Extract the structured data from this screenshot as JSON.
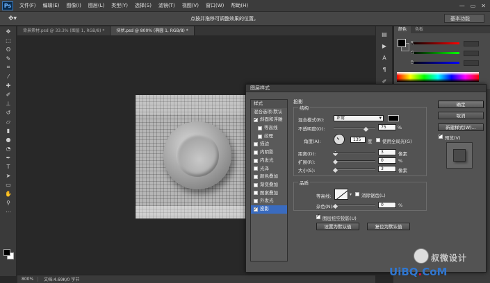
{
  "app": {
    "logo": "Ps"
  },
  "menu": [
    "文件(F)",
    "编辑(E)",
    "图像(I)",
    "图层(L)",
    "类型(Y)",
    "选择(S)",
    "滤镜(T)",
    "视图(V)",
    "窗口(W)",
    "帮助(H)"
  ],
  "window_controls": [
    "—",
    "▭",
    "✕"
  ],
  "options_bar": {
    "tool_icon": "move-tool",
    "hint": "点按并拖移可调整效果的位置。",
    "workspace": "基本功能"
  },
  "doc_tabs": [
    {
      "label": "背景素材.psd @ 33.3% (图层 1, RGB/8) *",
      "active": false
    },
    {
      "label": "块状.psd @ 800% (椭圆 1, RGB/8) *",
      "active": true
    }
  ],
  "status": {
    "zoom": "800%",
    "doc": "文档:4.69K/0 字节"
  },
  "color_panel": {
    "tabs": [
      "颜色",
      "色板"
    ],
    "sliders": [
      "R",
      "G",
      "B"
    ]
  },
  "dialog": {
    "title": "图层样式",
    "styles_header": "样式",
    "blend_options": "混合选项:默认",
    "styles": [
      {
        "label": "斜面和浮雕",
        "checked": true,
        "indent": false
      },
      {
        "label": "等高线",
        "checked": false,
        "indent": true
      },
      {
        "label": "纹理",
        "checked": false,
        "indent": true
      },
      {
        "label": "描边",
        "checked": false,
        "indent": false
      },
      {
        "label": "内阴影",
        "checked": false,
        "indent": false
      },
      {
        "label": "内发光",
        "checked": false,
        "indent": false
      },
      {
        "label": "光泽",
        "checked": false,
        "indent": false
      },
      {
        "label": "颜色叠加",
        "checked": false,
        "indent": false
      },
      {
        "label": "渐变叠加",
        "checked": false,
        "indent": false
      },
      {
        "label": "图案叠加",
        "checked": false,
        "indent": false
      },
      {
        "label": "外发光",
        "checked": false,
        "indent": false
      },
      {
        "label": "投影",
        "checked": true,
        "indent": false,
        "selected": true
      }
    ],
    "section": "投影",
    "structure": {
      "legend": "结构",
      "blend_mode_label": "混合模式(B):",
      "blend_mode_value": "正常",
      "opacity_label": "不透明度(O):",
      "opacity_value": "75",
      "opacity_unit": "%",
      "angle_label": "角度(A):",
      "angle_value": "135",
      "angle_unit": "度",
      "global_light_label": "使用全局光(G)",
      "distance_label": "距离(D):",
      "distance_value": "3",
      "distance_unit": "像素",
      "spread_label": "扩展(R):",
      "spread_value": "0",
      "spread_unit": "%",
      "size_label": "大小(S):",
      "size_value": "3",
      "size_unit": "像素"
    },
    "quality": {
      "legend": "品质",
      "contour_label": "等高线:",
      "antialias_label": "消除锯齿(L)",
      "noise_label": "杂色(N):",
      "noise_value": "0",
      "noise_unit": "%"
    },
    "knockout_label": "图层挖空投影(U)",
    "set_default": "设置为默认值",
    "reset_default": "复位为默认值",
    "buttons": {
      "ok": "确定",
      "cancel": "取消",
      "new_style": "新建样式(W)...",
      "preview": "预览(V)"
    }
  },
  "watermark": {
    "badge_text": "",
    "brand": "叔微设计",
    "site_a": "U",
    "site_b": "iBQ",
    "site_dot": ".",
    "site_c": "CoM"
  },
  "colors": {
    "accent": "#3a6bbf",
    "dialog_bg": "#535353",
    "panel_bg": "#4a4a4a"
  }
}
